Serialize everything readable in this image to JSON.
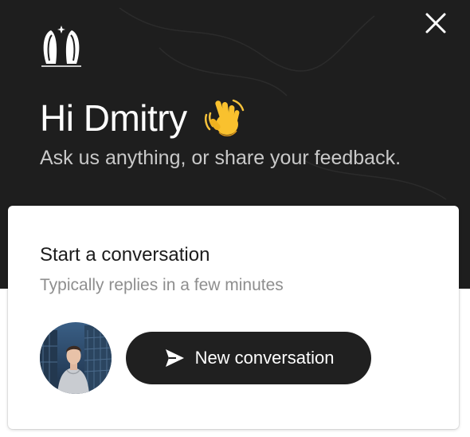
{
  "header": {
    "logo_icon": "bunny-ears-logo-icon",
    "close_icon": "close-icon",
    "greeting": "Hi Dmitry",
    "greeting_icon": "waving-hand-icon",
    "subtitle": "Ask us anything, or share your feedback."
  },
  "card": {
    "title": "Start a conversation",
    "subtitle": "Typically replies in a few minutes",
    "avatar_icon": "avatar",
    "button_label": "New conversation",
    "button_icon": "send-icon"
  },
  "colors": {
    "header_bg": "#1e1e1e",
    "button_bg": "#202020",
    "text_primary": "#1c1c1c",
    "text_secondary": "#8e8e8e"
  }
}
